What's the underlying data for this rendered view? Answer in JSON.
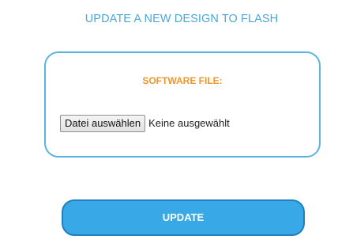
{
  "heading": "UPDATE A NEW DESIGN TO FLASH",
  "software_file": {
    "label": "SOFTWARE FILE:",
    "choose_button_label": "Datei auswählen",
    "status_text": "Keine ausgewählt"
  },
  "update_button_label": "UPDATE",
  "colors": {
    "heading": "#4aa8d8",
    "panel_border": "#5ab4e2",
    "label_accent": "#f0962a",
    "update_button_fill": "#38a9e6",
    "update_button_border": "#1f7fc0"
  }
}
